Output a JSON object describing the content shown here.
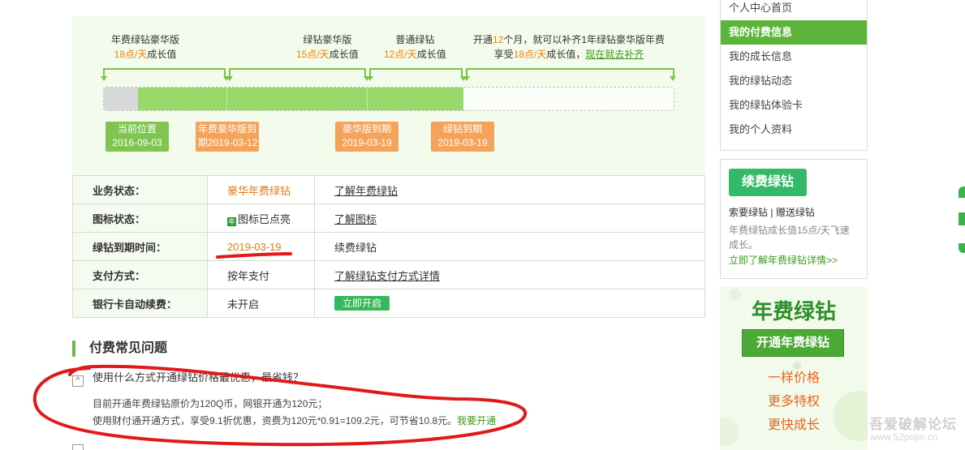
{
  "timeline": {
    "tiers": [
      {
        "name": "年费绿钻豪华版",
        "rate": "18点/天",
        "suffix": "成长值"
      },
      {
        "name": "绿钻豪华版",
        "rate": "15点/天",
        "suffix": "成长值"
      },
      {
        "name": "普通绿钻",
        "rate": "12点/天",
        "suffix": "成长值"
      }
    ],
    "promo_line1_a": "开通",
    "promo_line1_num": "12",
    "promo_line1_b": "个月，就可以补齐1年绿钻豪华版年费",
    "promo_line2_a": "享受",
    "promo_line2_rate": "18点/天",
    "promo_line2_b": "成长值，",
    "promo_link": "现在就去补齐",
    "markers": [
      {
        "label": "当前位置",
        "date": "2016-09-03"
      },
      {
        "label": "年费豪华版到",
        "date": "期2019-03-12"
      },
      {
        "label": "豪华版到期",
        "date": "2019-03-19"
      },
      {
        "label": "绿钻到期",
        "date": "2019-03-19"
      }
    ]
  },
  "status": {
    "rows": [
      {
        "key": "业务状态：",
        "value": "豪华年费绿钻",
        "action": "了解年费绿钻"
      },
      {
        "key": "图标状态：",
        "icon": "年",
        "value": "图标已点亮",
        "action": "了解图标"
      },
      {
        "key": "绿钻到期时间：",
        "value": "2019-03-19",
        "action": "续费绿钻"
      },
      {
        "key": "支付方式：",
        "value": "按年支付",
        "action": "了解绿钻支付方式详情"
      },
      {
        "key": "银行卡自动续费：",
        "value": "未开启",
        "action": "立即开启"
      }
    ]
  },
  "faq": {
    "title": "付费常见问题",
    "question": "使用什么方式开通绿钻价格最优惠，最省钱？",
    "answer_line1": "目前开通年费绿钻原价为120Q币，网银开通为120元；",
    "answer_line2": "使用财付通开通方式，享受9.1折优惠，资费为120元*0.91=109.2元，可节省10.8元。",
    "answer_link": "我要开通"
  },
  "sidebar": {
    "items": [
      {
        "label": "个人中心首页"
      },
      {
        "label": "我的付费信息"
      },
      {
        "label": "我的成长信息"
      },
      {
        "label": "我的绿钻动态"
      },
      {
        "label": "我的绿钻体验卡"
      },
      {
        "label": "我的个人资料"
      }
    ],
    "renew_button": "续费绿钻",
    "renew_link_a": "索要绿钻",
    "renew_sep": "|",
    "renew_link_b": "赠送绿钻",
    "renew_desc": "年费绿钻成长值15点/天飞速成长。",
    "renew_more": "立即了解年费绿钻详情>>",
    "promo_title": "年费绿钻",
    "promo_button": "开通年费绿钻",
    "promo_features": [
      "一样价格",
      "更多特权",
      "更快成长"
    ]
  },
  "watermark": {
    "text": "吾爱破解论坛",
    "url": "www.52pojie.cn"
  },
  "colors": {
    "brand_green": "#5cb53a",
    "accent_orange": "#f08200",
    "annotation_red": "#e0191b"
  }
}
